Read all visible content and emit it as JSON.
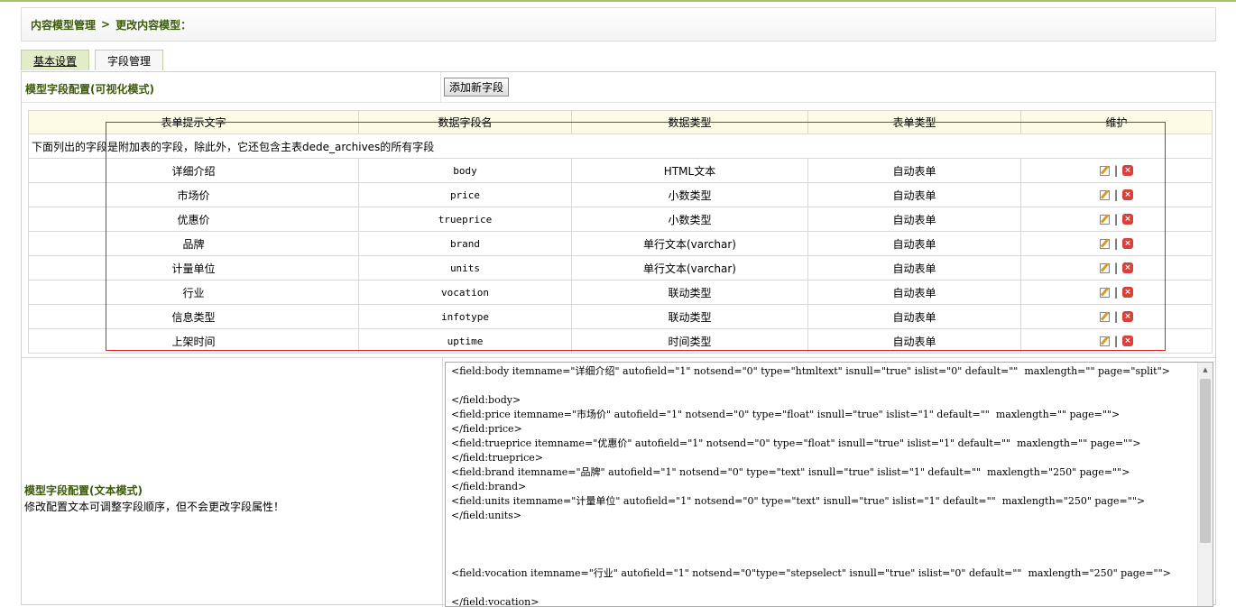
{
  "breadcrumb": {
    "item1": "内容模型管理",
    "sep": ">",
    "item2": "更改内容模型："
  },
  "tabs": [
    {
      "label": "基本设置",
      "active": true
    },
    {
      "label": "字段管理",
      "active": false
    }
  ],
  "visual_section": {
    "title": "模型字段配置(可视化模式)",
    "add_button": "添加新字段"
  },
  "table": {
    "headers": [
      "表单提示文字",
      "数据字段名",
      "数据类型",
      "表单类型",
      "维护"
    ],
    "note": "下面列出的字段是附加表的字段，除此外，它还包含主表dede_archives的所有字段",
    "rows": [
      {
        "label": "详细介绍",
        "field": "body",
        "dtype": "HTML文本",
        "ftype": "自动表单"
      },
      {
        "label": "市场价",
        "field": "price",
        "dtype": "小数类型",
        "ftype": "自动表单"
      },
      {
        "label": "优惠价",
        "field": "trueprice",
        "dtype": "小数类型",
        "ftype": "自动表单"
      },
      {
        "label": "品牌",
        "field": "brand",
        "dtype": "单行文本(varchar)",
        "ftype": "自动表单"
      },
      {
        "label": "计量单位",
        "field": "units",
        "dtype": "单行文本(varchar)",
        "ftype": "自动表单"
      },
      {
        "label": "行业",
        "field": "vocation",
        "dtype": "联动类型",
        "ftype": "自动表单"
      },
      {
        "label": "信息类型",
        "field": "infotype",
        "dtype": "联动类型",
        "ftype": "自动表单"
      },
      {
        "label": "上架时间",
        "field": "uptime",
        "dtype": "时间类型",
        "ftype": "自动表单"
      }
    ],
    "action_separator": "|",
    "edit_icon": "edit-icon",
    "delete_icon": "delete-icon",
    "highlight_color": "#e02020"
  },
  "text_section": {
    "title": "模型字段配置(文本模式)",
    "description": "修改配置文本可调整字段顺序，但不会更改字段属性！",
    "code_lines": [
      "<field:body itemname=\"详细介绍\" autofield=\"1\" notsend=\"0\" type=\"htmltext\" isnull=\"true\" islist=\"0\" default=\"\"  maxlength=\"\" page=\"split\">",
      "",
      "</field:body>",
      "<field:price itemname=\"市场价\" autofield=\"1\" notsend=\"0\" type=\"float\" isnull=\"true\" islist=\"1\" default=\"\"  maxlength=\"\" page=\"\">",
      "</field:price>",
      "<field:trueprice itemname=\"优惠价\" autofield=\"1\" notsend=\"0\" type=\"float\" isnull=\"true\" islist=\"1\" default=\"\"  maxlength=\"\" page=\"\">",
      "</field:trueprice>",
      "<field:brand itemname=\"品牌\" autofield=\"1\" notsend=\"0\" type=\"text\" isnull=\"true\" islist=\"1\" default=\"\"  maxlength=\"250\" page=\"\">",
      "</field:brand>",
      "<field:units itemname=\"计量单位\" autofield=\"1\" notsend=\"0\" type=\"text\" isnull=\"true\" islist=\"1\" default=\"\"  maxlength=\"250\" page=\"\">",
      "</field:units>",
      "",
      "",
      "",
      "<field:vocation itemname=\"行业\" autofield=\"1\" notsend=\"0\"type=\"stepselect\" isnull=\"true\" islist=\"0\" default=\"\"  maxlength=\"250\" page=\"\">",
      "",
      "</field:vocation>"
    ]
  },
  "colors": {
    "accent_green": "#3b5a0a",
    "header_bg": "#fbfbe6",
    "tab_active_bg": "#e3ecc9"
  }
}
